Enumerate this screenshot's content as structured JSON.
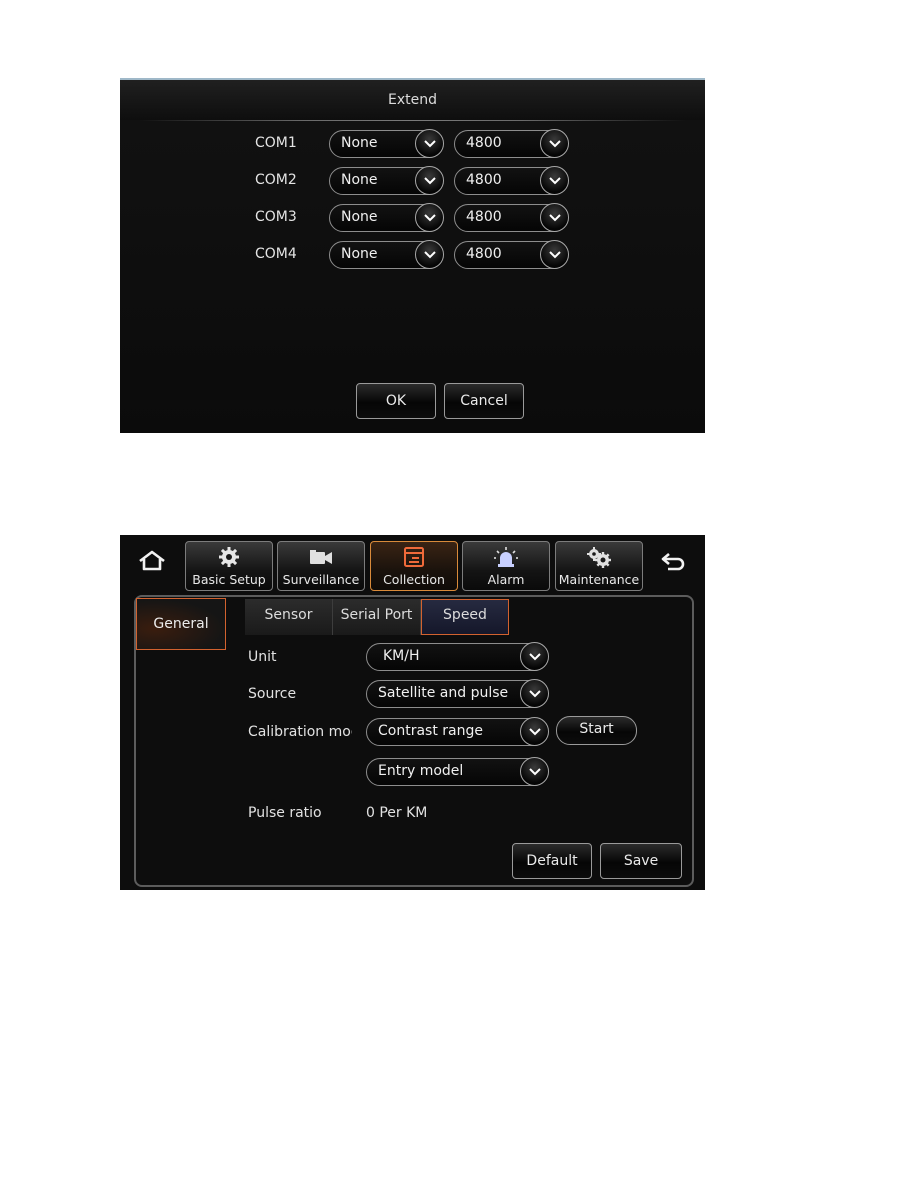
{
  "extend_dialog": {
    "title": "Extend",
    "ports": [
      {
        "label": "COM1",
        "device": "None",
        "baud": "4800"
      },
      {
        "label": "COM2",
        "device": "None",
        "baud": "4800"
      },
      {
        "label": "COM3",
        "device": "None",
        "baud": "4800"
      },
      {
        "label": "COM4",
        "device": "None",
        "baud": "4800"
      }
    ],
    "ok_label": "OK",
    "cancel_label": "Cancel"
  },
  "speed_screen": {
    "nav": {
      "home_icon": "home-icon",
      "back_icon": "back-arrow-icon",
      "tabs": [
        {
          "label": "Basic Setup",
          "icon": "gear-icon"
        },
        {
          "label": "Surveillance",
          "icon": "camera-icon"
        },
        {
          "label": "Collection",
          "icon": "collection-icon",
          "active": true
        },
        {
          "label": "Alarm",
          "icon": "siren-icon"
        },
        {
          "label": "Maintenance",
          "icon": "gears-icon"
        }
      ]
    },
    "sidebar": {
      "items": [
        {
          "label": "General",
          "active": true
        }
      ]
    },
    "sub_tabs": [
      {
        "label": "Sensor"
      },
      {
        "label": "Serial Port"
      },
      {
        "label": "Speed",
        "active": true
      }
    ],
    "form": {
      "unit_label": "Unit",
      "unit_value": "KM/H",
      "source_label": "Source",
      "source_value": "Satellite and pulse",
      "calibration_label": "Calibration mod",
      "calibration_value": "Contrast range",
      "start_label": "Start",
      "entry_value": "Entry model",
      "pulse_label": "Pulse ratio",
      "pulse_value": "0 Per KM"
    },
    "default_label": "Default",
    "save_label": "Save"
  },
  "colors": {
    "accent_orange": "#d2622f",
    "background": "#0c0c0c",
    "border_gray": "#8d8d8d"
  }
}
